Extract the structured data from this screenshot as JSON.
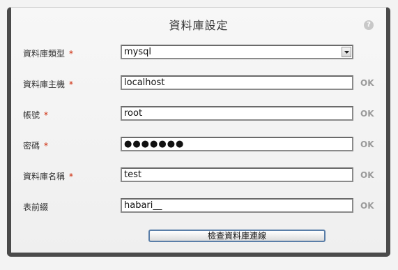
{
  "dialog": {
    "title": "資料庫設定",
    "help_icon": "question-mark-icon"
  },
  "fields": [
    {
      "label": "資料庫類型",
      "required": "*",
      "value": "mysql",
      "type": "select",
      "status": ""
    },
    {
      "label": "資料庫主機",
      "required": "*",
      "value": "localhost",
      "type": "text",
      "status": "OK"
    },
    {
      "label": "帳號",
      "required": "*",
      "value": "root",
      "type": "text",
      "status": "OK"
    },
    {
      "label": "密碼",
      "required": "*",
      "value": "●●●●●●●",
      "type": "password",
      "status": "OK"
    },
    {
      "label": "資料庫名稱",
      "required": "*",
      "value": "test",
      "type": "text",
      "status": "OK"
    },
    {
      "label": "表前綴",
      "required": "",
      "value": "habari__",
      "type": "text",
      "status": "OK"
    }
  ],
  "check_button": {
    "label": "檢查資料庫連線"
  },
  "colors": {
    "frame": "#4a4a4a",
    "required": "#cc2200",
    "ok": "#9a9a9a",
    "button_border": "#5a7ea8"
  }
}
